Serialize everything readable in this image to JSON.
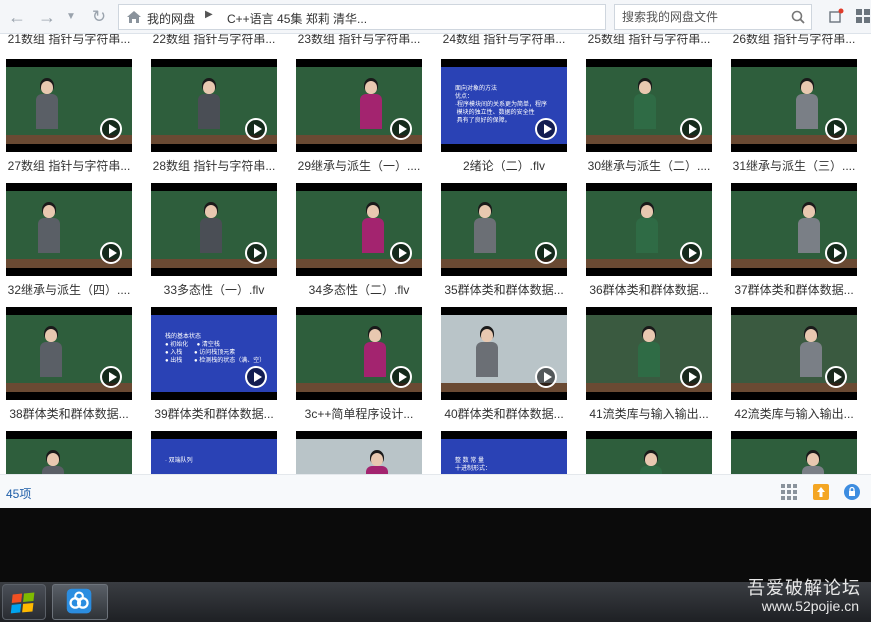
{
  "toolbar": {
    "back_icon": "arrow-left-icon",
    "forward_icon": "arrow-right-icon",
    "refresh_icon": "refresh-icon",
    "breadcrumb_root": "我的网盘",
    "breadcrumb_path": "C++语言 45集 郑莉 清华...",
    "search_placeholder": "搜索我的网盘文件"
  },
  "top_row_captions": [
    "21数组 指针与字符串...",
    "22数组 指针与字符串...",
    "23数组 指针与字符串...",
    "24数组 指针与字符串...",
    "25数组 指针与字符串...",
    "26数组 指针与字符串..."
  ],
  "files": [
    {
      "name": "27数组 指针与字符串...",
      "kind": "board"
    },
    {
      "name": "28数组 指针与字符串...",
      "kind": "board"
    },
    {
      "name": "29继承与派生（一）....",
      "kind": "board"
    },
    {
      "name": "2绪论（二）.flv",
      "kind": "slide",
      "slide_text": "面向对象的方法\n优点：\n·程序模块间的关系更为简单，程序\n 模块的独立性、数据的安全性\n 具有了良好的保障。"
    },
    {
      "name": "30继承与派生（二）....",
      "kind": "board"
    },
    {
      "name": "31继承与派生（三）....",
      "kind": "board"
    },
    {
      "name": "32继承与派生（四）....",
      "kind": "board"
    },
    {
      "name": "33多态性（一）.flv",
      "kind": "board"
    },
    {
      "name": "34多态性（二）.flv",
      "kind": "board"
    },
    {
      "name": "35群体类和群体数据...",
      "kind": "board"
    },
    {
      "name": "36群体类和群体数据...",
      "kind": "board"
    },
    {
      "name": "37群体类和群体数据...",
      "kind": "board"
    },
    {
      "name": "38群体类和群体数据...",
      "kind": "board"
    },
    {
      "name": "39群体类和群体数据...",
      "kind": "slide",
      "slide_text": "栈的基本状态\n● 初始化     ● 清空栈\n● 入栈       ● 访问栈顶元素\n● 出栈       ● 检测栈的状态（满、空）"
    },
    {
      "name": "3c++简单程序设计...",
      "kind": "board"
    },
    {
      "name": "40群体类和群体数据...",
      "kind": "projector"
    },
    {
      "name": "41流类库与输入输出...",
      "kind": "doc"
    },
    {
      "name": "42流类库与输入输出...",
      "kind": "doc"
    },
    {
      "name": "",
      "kind": "board"
    },
    {
      "name": "",
      "kind": "slide",
      "slide_text": "· 双端队列"
    },
    {
      "name": "",
      "kind": "projector"
    },
    {
      "name": "",
      "kind": "slide",
      "slide_text": "整 数 常 量\n十进制形式："
    },
    {
      "name": "",
      "kind": "board"
    },
    {
      "name": "",
      "kind": "board"
    }
  ],
  "statusbar": {
    "count": "45项",
    "grid_view_icon": "grid-view-icon",
    "upload_icon": "upload-icon",
    "lock_icon": "lock-icon"
  },
  "taskbar": {
    "start_icon": "windows-start-icon",
    "app_icon": "baidu-netdisk-icon"
  },
  "watermark": {
    "line1": "吾爱破解论坛",
    "line2": "www.52pojie.cn"
  },
  "colors": {
    "board": "#2e5e3c",
    "slide": "#2a42b5",
    "link": "#1e5ea8"
  }
}
